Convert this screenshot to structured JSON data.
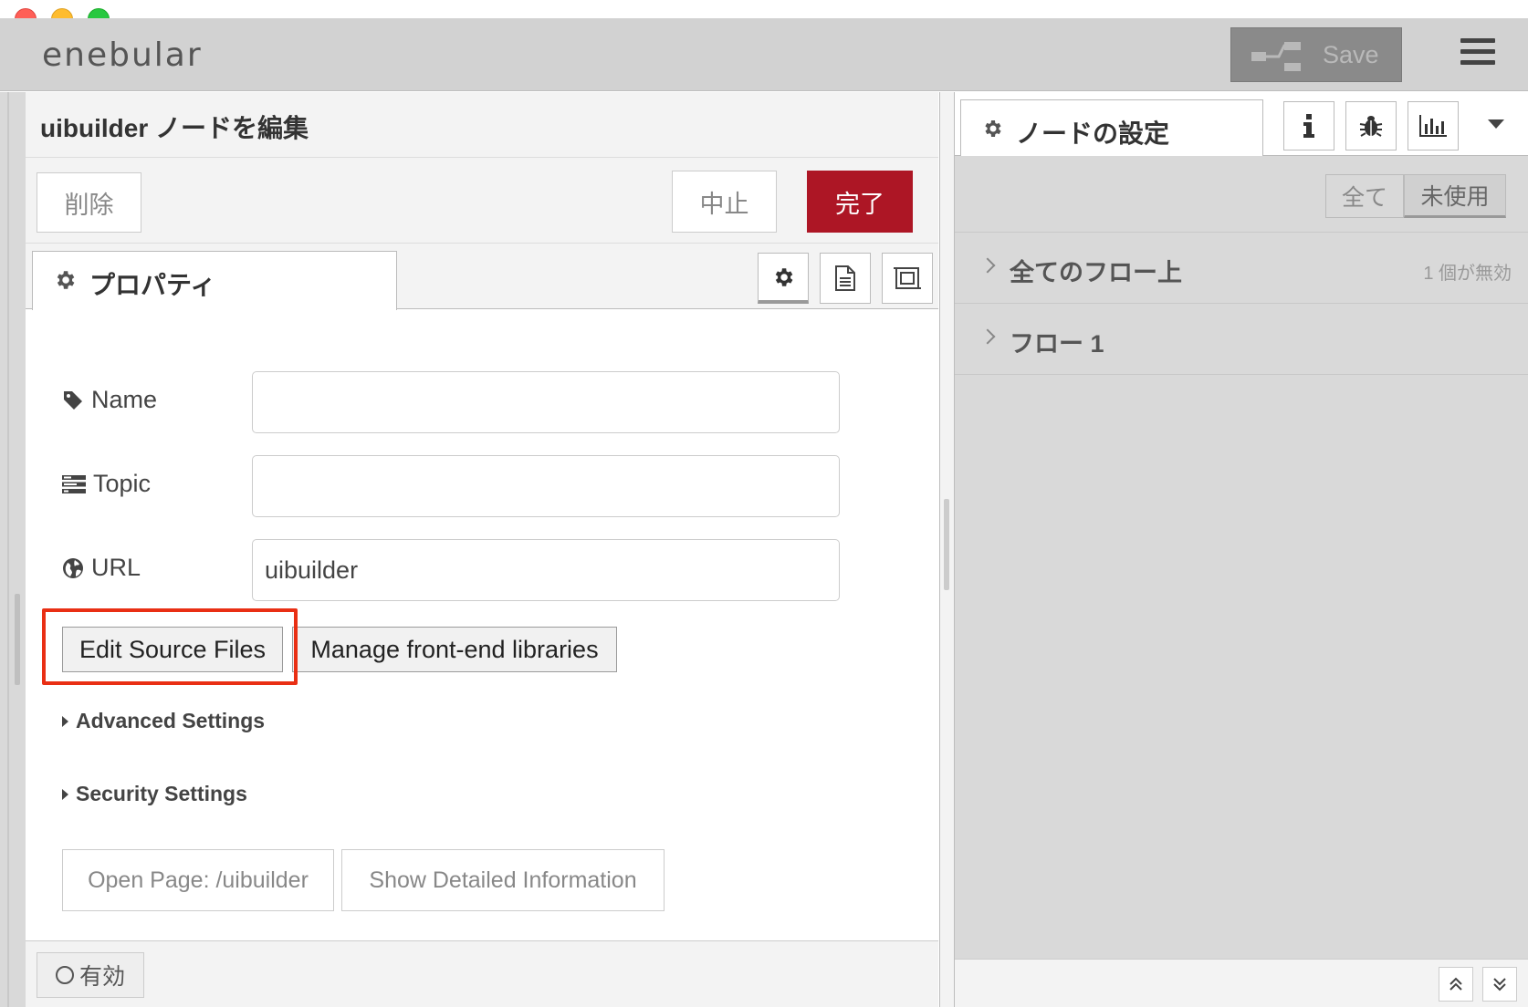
{
  "app": {
    "logo": "enebular",
    "save_label": "Save"
  },
  "tray": {
    "title": "uibuilder ノードを編集",
    "delete_label": "削除",
    "cancel_label": "中止",
    "done_label": "完了",
    "tab_properties": "プロパティ"
  },
  "form": {
    "name_label": "Name",
    "name_value": "",
    "topic_label": "Topic",
    "topic_value": "",
    "url_label": "URL",
    "url_value": "uibuilder"
  },
  "buttons": {
    "edit_source": "Edit Source Files",
    "manage_libs": "Manage front-end libraries",
    "open_page": "Open Page: /uibuilder",
    "show_info": "Show Detailed Information"
  },
  "sections": {
    "advanced": "Advanced Settings",
    "security": "Security Settings"
  },
  "footer": {
    "enable_label": "有効"
  },
  "sidebar": {
    "tab_title": "ノードの設定",
    "filter_all": "全て",
    "filter_unused": "未使用",
    "rows": [
      {
        "label": "全てのフロー上",
        "count": "1 個が無効"
      },
      {
        "label": "フロー 1",
        "count": ""
      }
    ]
  },
  "colors": {
    "done_button": "#ad1625",
    "highlight": "#e92f14",
    "header_bg": "#d2d2d2"
  }
}
